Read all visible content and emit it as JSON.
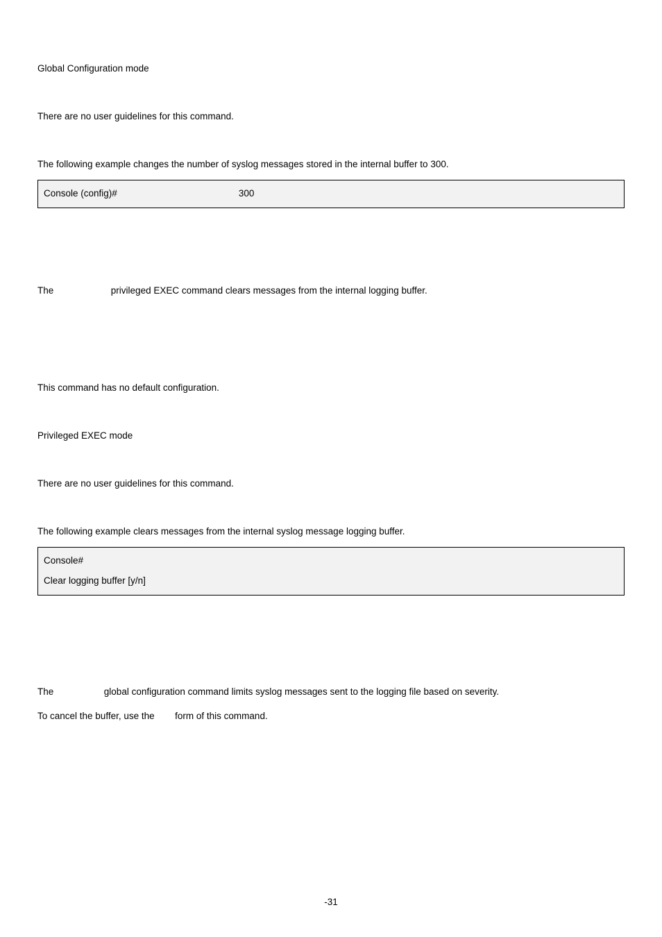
{
  "sec1": {
    "mode": "Global Configuration mode",
    "guidelines": "There are no user guidelines for this command.",
    "example_intro": "The following example changes the number of syslog messages stored in the internal buffer to 300.",
    "code_prompt": "Console (config)#",
    "code_value": "300"
  },
  "sec2": {
    "desc_pre": "The",
    "desc_rest": "privileged EXEC command clears messages from the internal logging buffer.",
    "default_cfg": "This command has no default configuration.",
    "mode": "Privileged EXEC mode",
    "guidelines": "There are no user guidelines for this command.",
    "example_intro": "The following example clears messages from the internal syslog message logging buffer.",
    "code_line1": "Console#",
    "code_line2": "Clear logging buffer [y/n]"
  },
  "sec3": {
    "line1_pre": "The",
    "line1_rest": "global configuration command limits syslog messages sent to the logging file based on severity.",
    "line2_pre": "To cancel the buffer, use the",
    "line2_rest": "form of this command."
  },
  "footer": {
    "page": "-31"
  }
}
